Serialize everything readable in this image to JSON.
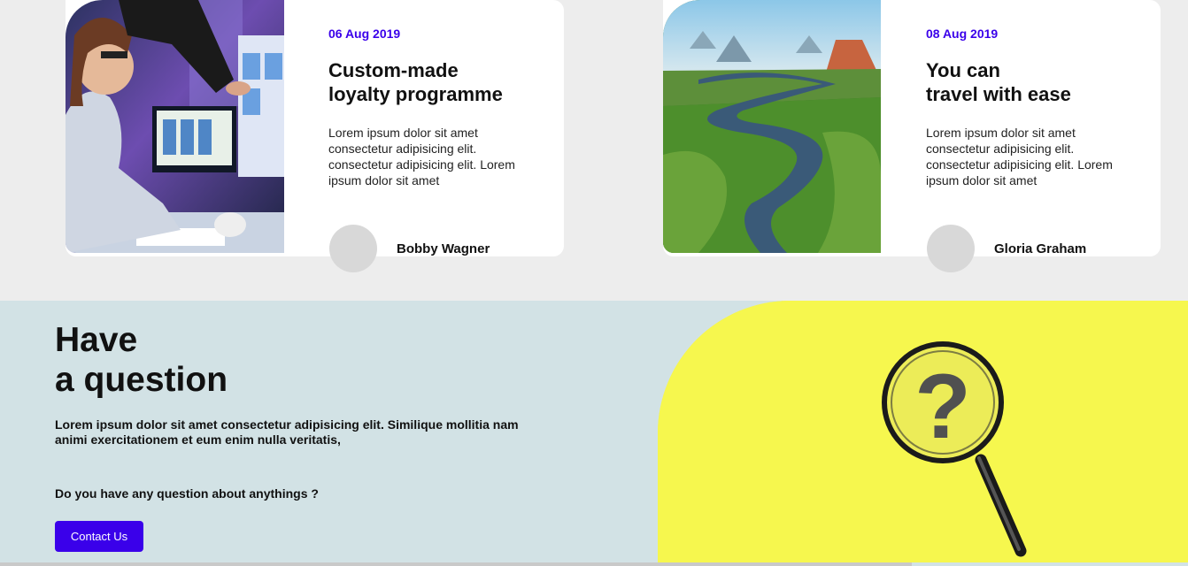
{
  "cards": [
    {
      "date": "06 Aug 2019",
      "title_line1": "Custom-made",
      "title_line2": "loyalty programme",
      "text": "Lorem ipsum dolor sit amet consectetur adipisicing elit. consectetur adipisicing elit. Lorem ipsum dolor sit amet",
      "author": "Bobby Wagner",
      "image": "designer-at-computer-photo"
    },
    {
      "date": "08 Aug 2019",
      "title_line1": "You can",
      "title_line2": "travel with ease",
      "text": "Lorem ipsum dolor sit amet consectetur adipisicing elit. consectetur adipisicing elit. Lorem ipsum dolor sit amet",
      "author": "Gloria Graham",
      "image": "river-landscape-photo"
    }
  ],
  "question": {
    "title_line1": "Have",
    "title_line2": "a question",
    "text": "Lorem ipsum dolor sit amet consectetur adipisicing elit. Similique mollitia nam animi exercitationem et eum enim nulla veritatis,",
    "prompt": "Do you have any question about anythings ?",
    "button_label": "Contact Us",
    "image": "magnifying-glass-question-photo"
  },
  "colors": {
    "accent": "#3a00ea",
    "page_bg": "#ededed",
    "question_bg": "#d2e2e5",
    "question_image_bg": "#f6f74e"
  }
}
